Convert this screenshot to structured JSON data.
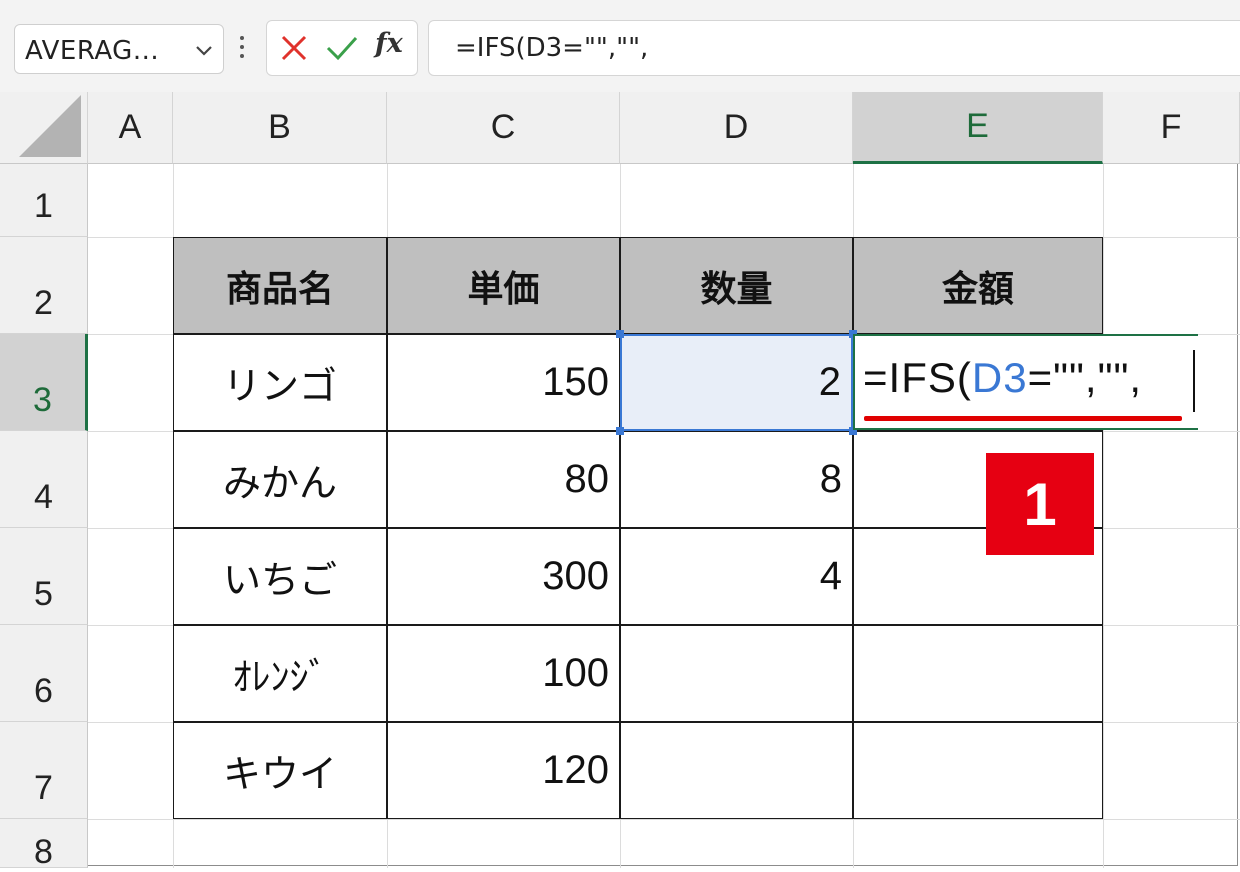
{
  "formula_bar": {
    "name_box": "AVERAG...",
    "cancel_icon": "close-icon",
    "enter_icon": "checkmark-icon",
    "fx_label": "fx",
    "formula_text": "=IFS(D3=\"\",\"\","
  },
  "columns": [
    "A",
    "B",
    "C",
    "D",
    "E",
    "F"
  ],
  "rows": [
    "1",
    "2",
    "3",
    "4",
    "5",
    "6",
    "7",
    "8"
  ],
  "table": {
    "headers": [
      "商品名",
      "単価",
      "数量",
      "金額"
    ],
    "rows": [
      {
        "name": "リンゴ",
        "price": "150",
        "qty": "2"
      },
      {
        "name": "みかん",
        "price": "80",
        "qty": "8"
      },
      {
        "name": "いちご",
        "price": "300",
        "qty": "4"
      },
      {
        "name": "ｵﾚﾝｼﾞ",
        "price": "100",
        "qty": ""
      },
      {
        "name": "キウイ",
        "price": "120",
        "qty": ""
      }
    ]
  },
  "editing_cell": {
    "prefix": "=IFS(",
    "reference": "D3",
    "suffix": "=\"\",\"\","
  },
  "annotation_badge": "1",
  "colors": {
    "accent_green": "#1e7145",
    "reference_blue": "#3a78d4",
    "badge_red": "#e60012",
    "header_fill": "#bfbfbf"
  }
}
